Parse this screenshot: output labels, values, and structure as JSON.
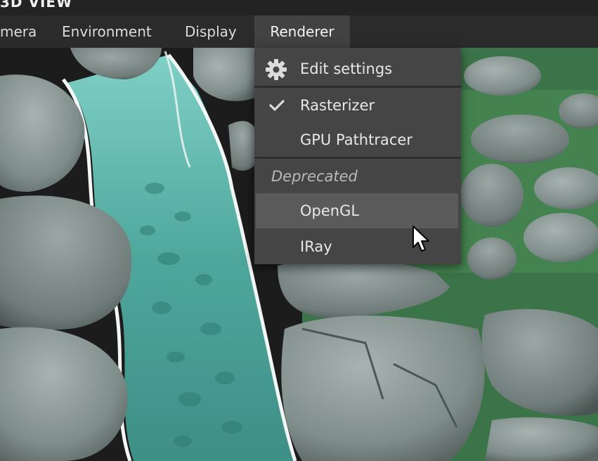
{
  "window": {
    "title": "3D VIEW"
  },
  "menubar": {
    "items": [
      {
        "label": "mera"
      },
      {
        "label": "Environment"
      },
      {
        "label": "Display"
      },
      {
        "label": "Renderer"
      }
    ],
    "active_index": 3
  },
  "renderer_menu": {
    "edit_settings": {
      "label": "Edit settings",
      "icon": "gear-icon"
    },
    "rasterizer": {
      "label": "Rasterizer",
      "checked": true,
      "icon": "checkmark-icon"
    },
    "gpu_pathtracer": {
      "label": "GPU Pathtracer",
      "checked": false
    },
    "deprecated_section": {
      "label": "Deprecated"
    },
    "opengl": {
      "label": "OpenGL",
      "hovered": true
    },
    "iray": {
      "label": "IRay"
    }
  },
  "colors": {
    "menu_bg": "#454545",
    "menu_highlight": "#5a5a5a",
    "menubar_bg": "#2b2b2b",
    "active_menu_bg": "#424242"
  }
}
